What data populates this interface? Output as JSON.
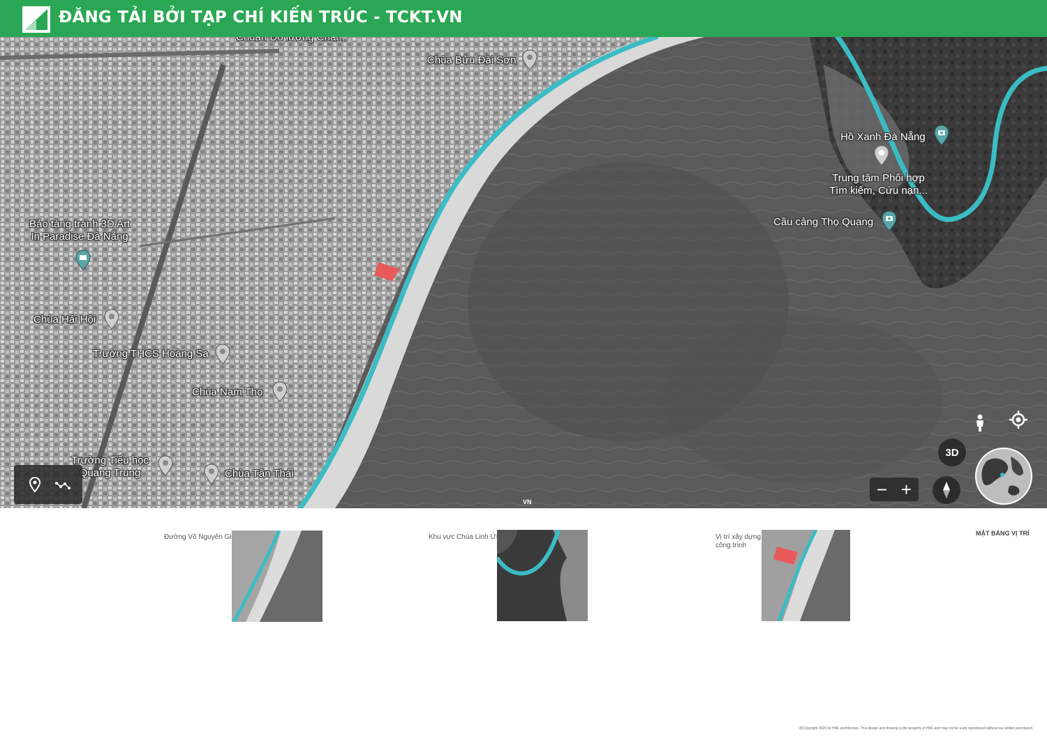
{
  "banner": {
    "title": "ĐĂNG TẢI BỞI TẠP CHÍ KIẾN TRÚC - TCKT.VN",
    "background_color": "#2aa754"
  },
  "map": {
    "route_color": "#3bbcc4",
    "site_color": "#e85a5a",
    "labels": {
      "top_cut": "Chuẩn Đo lường Chất...",
      "chua_buu_dai_son": "Chùa Bửu Đài Sơn",
      "ho_xanh": "Hồ Xanh Đà Nẵng",
      "trung_tam": "Trung tâm Phối hợp\nTìm kiếm, Cứu nạn...",
      "cau_cang": "Cầu cảng Thọ Quang",
      "bao_tang": "Bảo tàng tranh 3D Art\nIn Paradise Đà Nẵng",
      "chua_hai_hoi": "Chùa Hải Hội",
      "truong_thcs": "Trường THCS Hoàng Sa",
      "chua_nam_tho": "Chùa Nam Thọ",
      "truong_tieu_hoc": "Trường Tiểu học\nQuang Trung",
      "chua_tan_thai": "Chùa Tân Thái"
    },
    "controls": {
      "three_d_label": "3D",
      "zoom_out_label": "−",
      "zoom_in_label": "+",
      "vn_label": "VN",
      "icons": [
        "location-pin-icon",
        "route-icon",
        "pegman-icon",
        "my-location-icon",
        "compass-icon",
        "globe-icon"
      ]
    }
  },
  "details": {
    "items": [
      {
        "caption": "Đường Võ Nguyên Giáp"
      },
      {
        "caption": "Khu vực Chùa Linh Ứng"
      },
      {
        "caption": "Vị trí xây dựng\ncông trình"
      }
    ],
    "page_title": "MẶT BẰNG VỊ TRÍ",
    "copyright": "@Copyright 2020 by HML architecture. This design and drawing is the property of HML and may not be used reproduced without our written permission"
  }
}
